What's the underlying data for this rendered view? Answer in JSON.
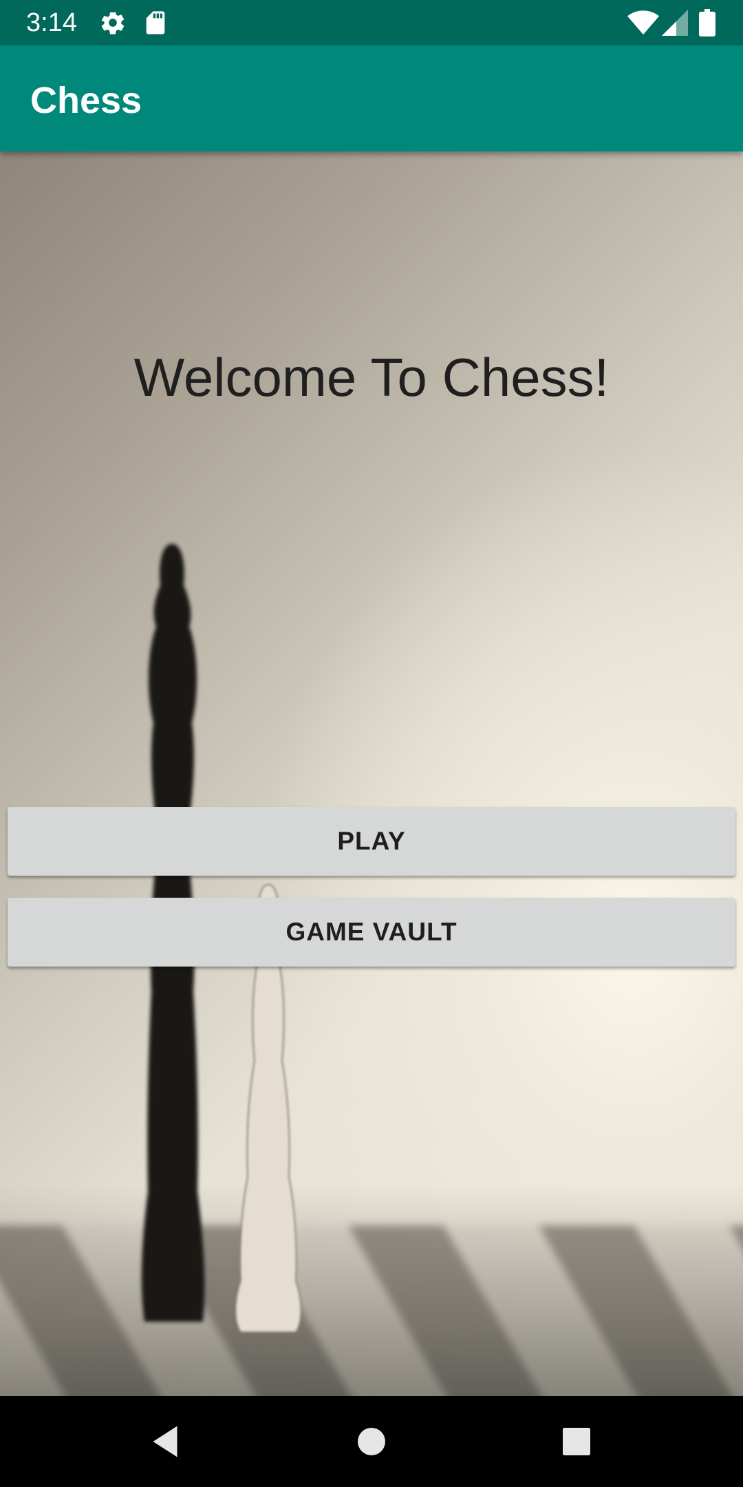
{
  "status_bar": {
    "time": "3:14",
    "icons": [
      "settings-icon",
      "sd-card-icon",
      "wifi-icon",
      "signal-icon",
      "battery-icon"
    ]
  },
  "app_bar": {
    "title": "Chess",
    "color": "#00897b",
    "status_color": "#00695c"
  },
  "main": {
    "welcome_text": "Welcome To Chess!",
    "buttons": [
      {
        "label": "PLAY"
      },
      {
        "label": "GAME VAULT"
      }
    ],
    "background": "chess pieces photo"
  },
  "nav_bar": {
    "icons": [
      "back-icon",
      "home-icon",
      "recents-icon"
    ]
  }
}
